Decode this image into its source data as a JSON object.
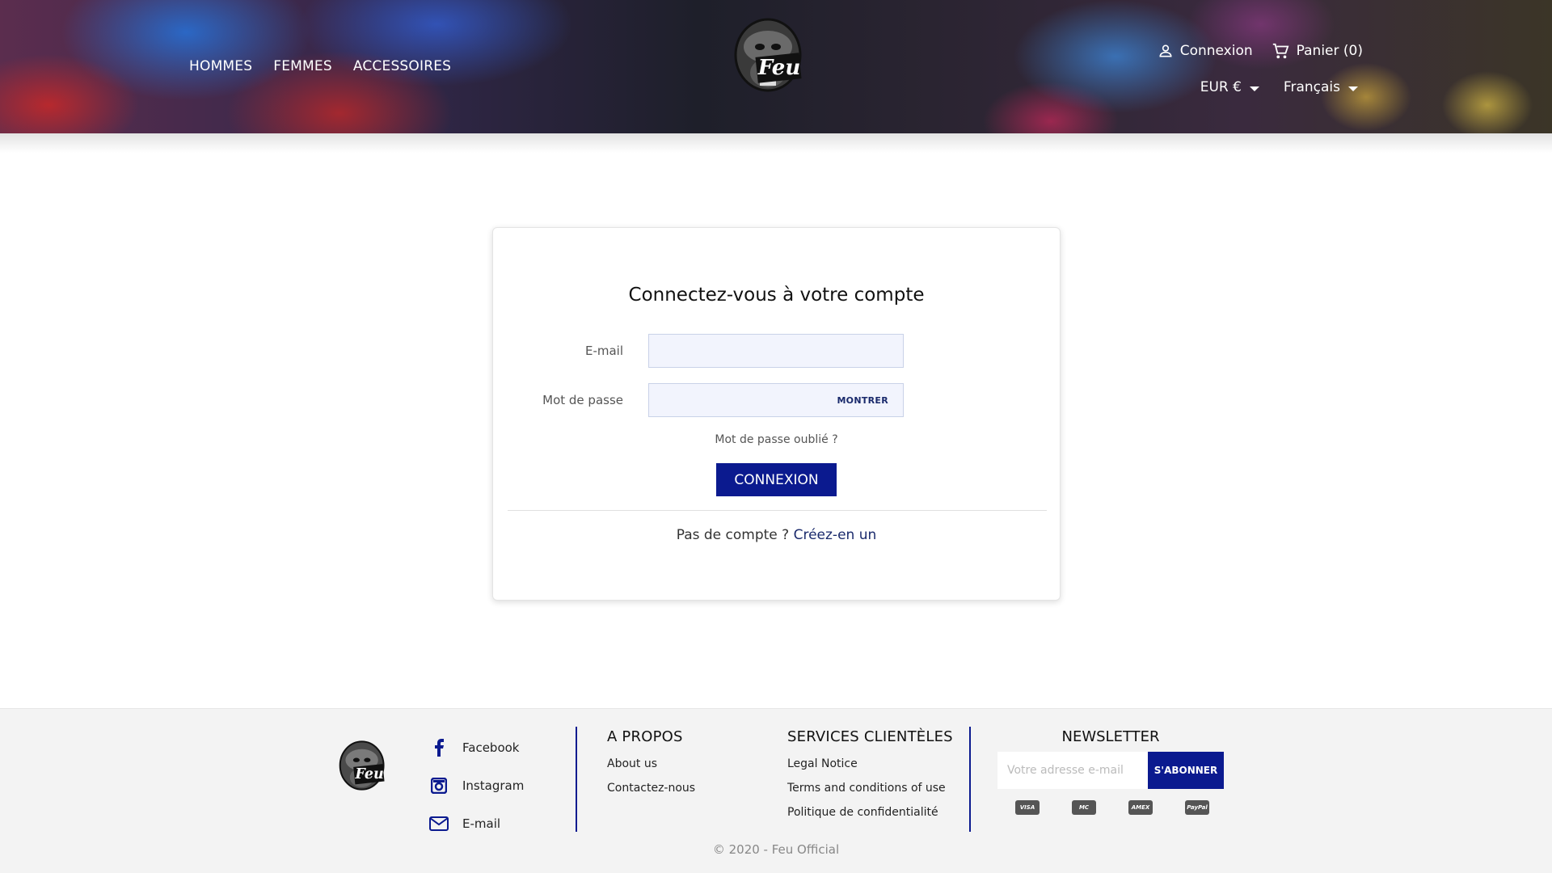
{
  "header": {
    "nav": [
      "HOMMES",
      "FEMMES",
      "ACCESSOIRES"
    ],
    "logo_text": "Feu",
    "signin_label": "Connexion",
    "cart_label": "Panier (0)",
    "currency": "EUR €",
    "language": "Français"
  },
  "login": {
    "title": "Connectez-vous à votre compte",
    "email_label": "E-mail",
    "email_value": "",
    "password_label": "Mot de passe",
    "password_value": "",
    "show_label": "MONTRER",
    "forgot_label": "Mot de passe oublié ?",
    "submit_label": "CONNEXION",
    "no_account_text": "Pas de compte ?",
    "create_label": "Créez-en un"
  },
  "footer": {
    "logo_text": "Feu",
    "social": [
      "Facebook",
      "Instagram",
      "E-mail"
    ],
    "about": {
      "title": "A PROPOS",
      "links": [
        "About us",
        "Contactez-nous"
      ]
    },
    "services": {
      "title": "SERVICES CLIENTÈLES",
      "links": [
        "Legal Notice",
        "Terms and conditions of use",
        "Politique de confidentialité"
      ]
    },
    "newsletter": {
      "title": "NEWSLETTER",
      "placeholder": "Votre adresse e-mail",
      "button": "S'ABONNER"
    },
    "payment_icons": [
      "visa-icon",
      "mastercard-icon",
      "amex-icon",
      "paypal-icon"
    ],
    "payment_labels": [
      "VISA",
      "MC",
      "AMEX",
      "PayPal"
    ],
    "copyright": "© 2020 - Feu Official"
  },
  "colors": {
    "accent": "#0b1a8f",
    "input_bg": "#f2f4fd",
    "footer_bg": "#f3f3f3"
  }
}
